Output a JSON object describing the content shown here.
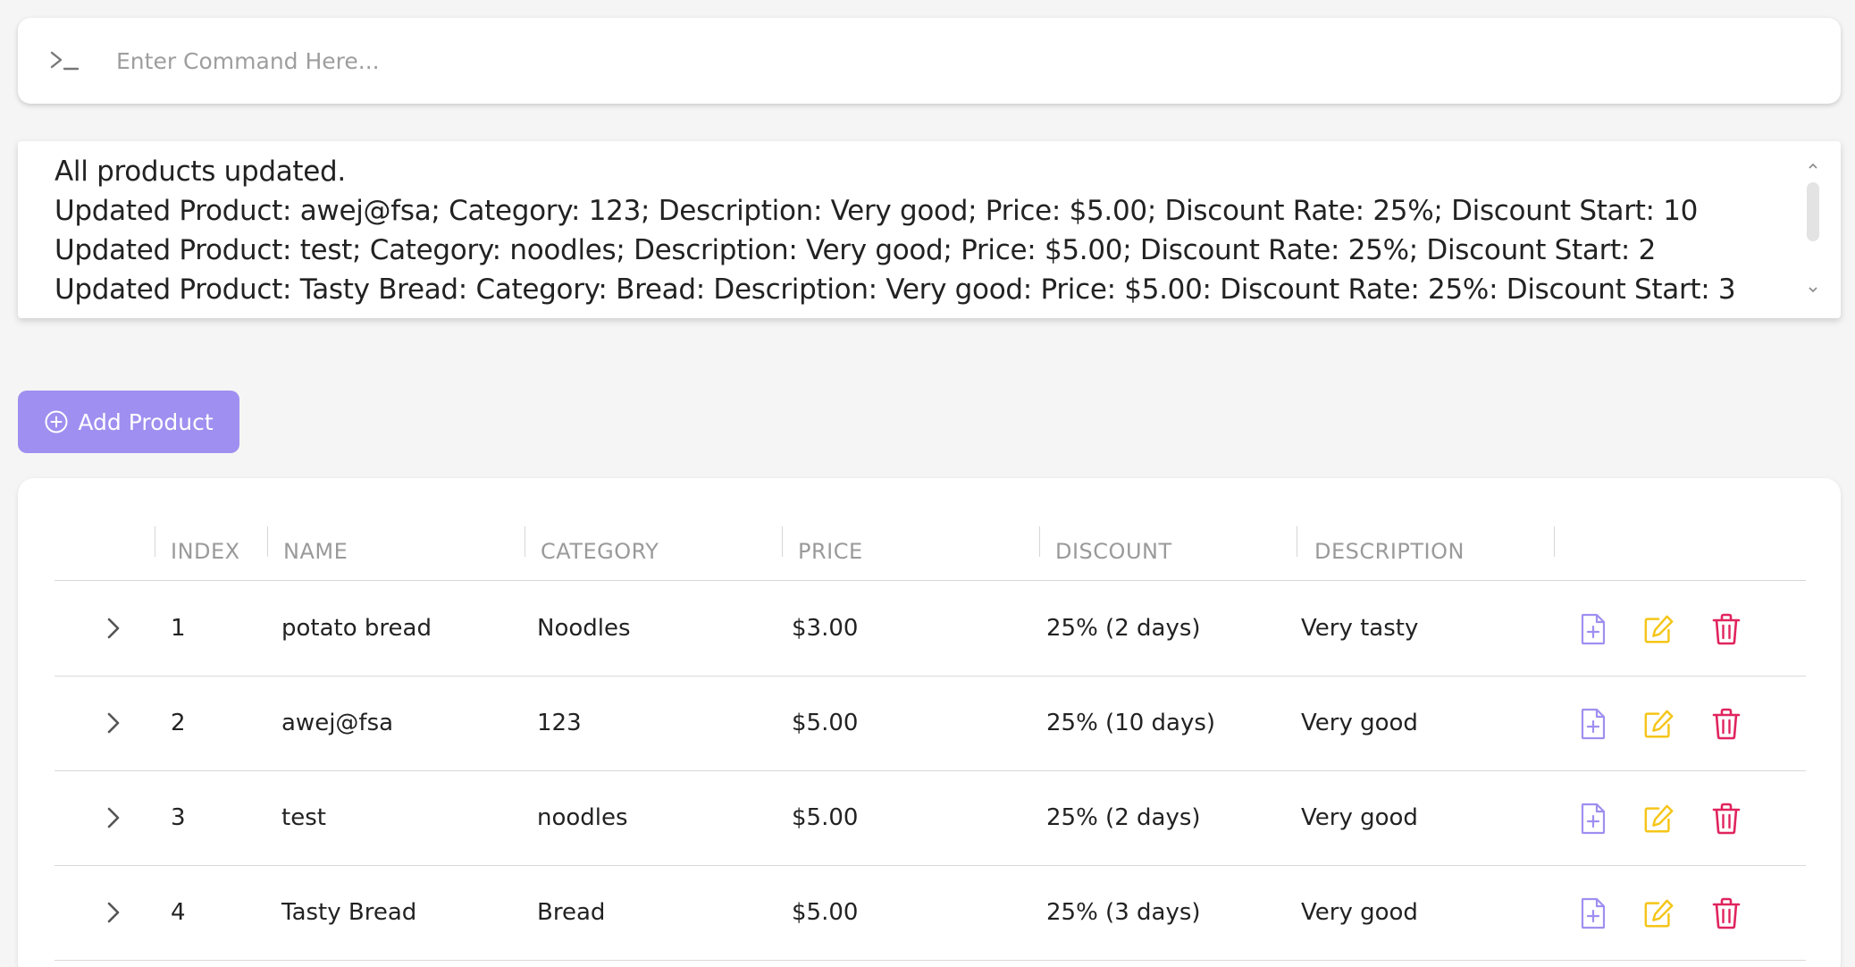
{
  "command": {
    "placeholder": "Enter Command Here...",
    "value": ""
  },
  "output": {
    "lines": [
      "All products updated.",
      "Updated Product: awej@fsa; Category: 123; Description: Very good; Price: $5.00; Discount Rate: 25%; Discount Start: 10",
      "Updated Product: test; Category: noodles; Description: Very good; Price: $5.00; Discount Rate: 25%; Discount Start: 2",
      "Updated Product: Tasty Bread: Category: Bread: Description: Very good: Price: $5.00: Discount Rate: 25%: Discount Start: 3"
    ]
  },
  "add_button": {
    "label": "Add Product"
  },
  "table": {
    "columns": [
      "INDEX",
      "NAME",
      "CATEGORY",
      "PRICE",
      "DISCOUNT",
      "DESCRIPTION"
    ],
    "rows": [
      {
        "index": "1",
        "name": "potato bread",
        "category": "Noodles",
        "price": "$3.00",
        "discount": "25% (2 days)",
        "description": "Very tasty"
      },
      {
        "index": "2",
        "name": "awej@fsa",
        "category": "123",
        "price": "$5.00",
        "discount": "25% (10 days)",
        "description": "Very good"
      },
      {
        "index": "3",
        "name": "test",
        "category": "noodles",
        "price": "$5.00",
        "discount": "25% (2 days)",
        "description": "Very good"
      },
      {
        "index": "4",
        "name": "Tasty Bread",
        "category": "Bread",
        "price": "$5.00",
        "discount": "25% (3 days)",
        "description": "Very good"
      }
    ]
  },
  "colors": {
    "accent": "#9f8ff0",
    "duplicate_icon": "#9f8ff0",
    "edit_icon": "#f5c518",
    "delete_icon": "#e0245e"
  },
  "icons": {
    "prompt": "terminal-prompt-icon",
    "add": "plus-circle-icon",
    "expand": "chevron-right-icon",
    "duplicate": "file-plus-icon",
    "edit": "edit-icon",
    "delete": "trash-icon"
  }
}
